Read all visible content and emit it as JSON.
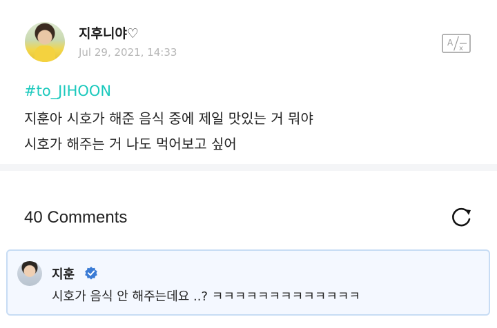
{
  "post": {
    "username": "지후니야♡",
    "timestamp": "Jul 29, 2021, 14:33",
    "hashtag": "#to_JIHOON",
    "lines": [
      "지훈아 시호가 해준 음식 중에 제일 맛있는 거 뭐야",
      "시호가 해주는 거 나도 먹어보고 싶어"
    ],
    "translate_icon": "translate-icon"
  },
  "comments": {
    "count_label": "40 Comments",
    "refresh_icon": "refresh-icon",
    "items": [
      {
        "name": "지훈",
        "verified": true,
        "text": "시호가 음식 안 해주는데요 ..? ㅋㅋㅋㅋㅋㅋㅋㅋㅋㅋㅋㅋㅋ"
      }
    ]
  },
  "colors": {
    "hashtag": "#1cc9bd",
    "verified_badge": "#3a7bd5",
    "comment_highlight_bg": "#f4f8ff",
    "comment_highlight_border": "#c7dcf4"
  }
}
